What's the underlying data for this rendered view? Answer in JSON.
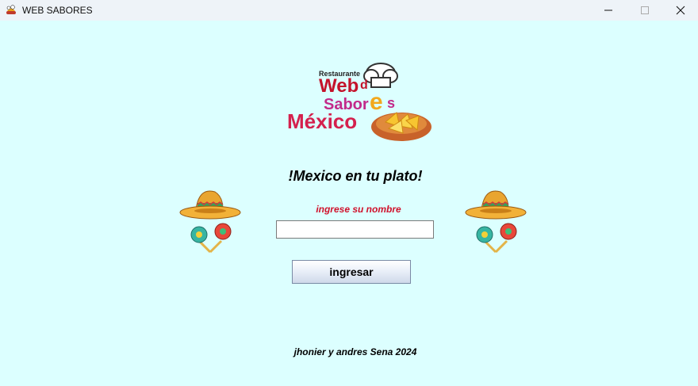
{
  "window": {
    "title": "WEB SABORES",
    "icon": "app-icon",
    "controls": [
      "minimize-icon",
      "maximize-icon",
      "close-icon"
    ]
  },
  "logo": {
    "line1": "Restaurante",
    "line2": "Web",
    "line2b": "d",
    "line3": "Sabor",
    "line3b": "e",
    "line3c": "s",
    "line4": "México"
  },
  "main": {
    "slogan": "!Mexico en tu plato!",
    "name_label": "ingrese su nombre",
    "name_input_value": "",
    "submit_label": "ingresar"
  },
  "footer": {
    "credits": "jhonier y andres Sena 2024"
  },
  "decorations": [
    "sombrero-maracas-icon",
    "sombrero-maracas-icon"
  ],
  "colors": {
    "background": "#dcffff",
    "label_red": "#d0112b"
  }
}
